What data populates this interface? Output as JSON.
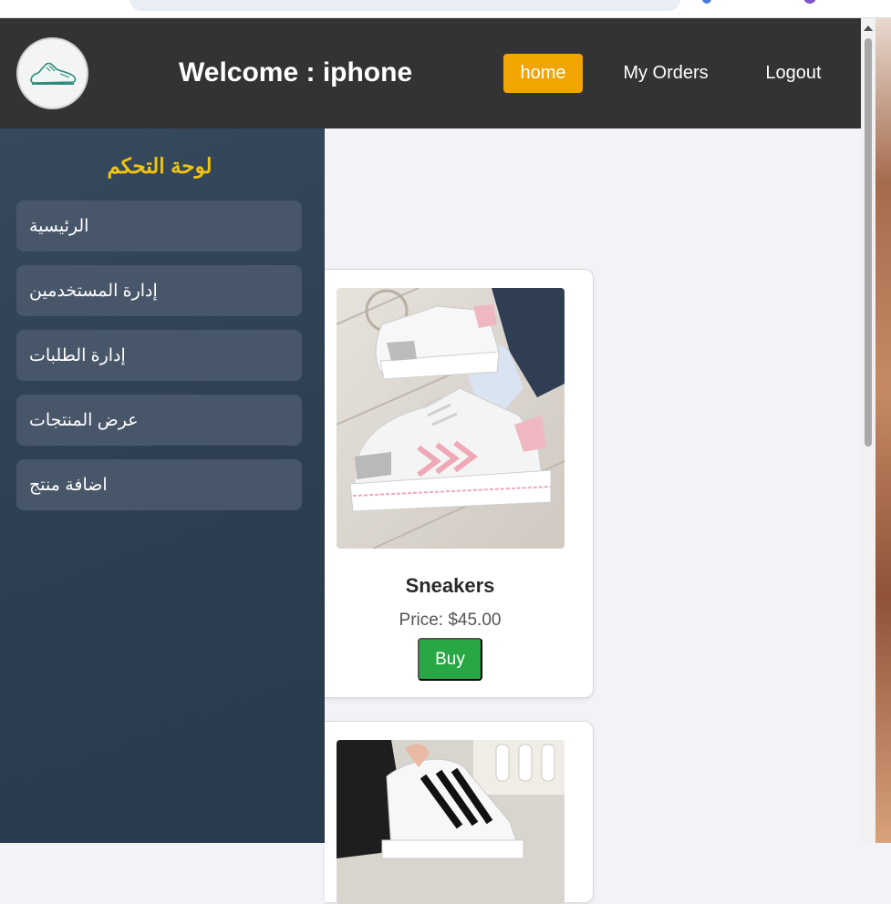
{
  "header": {
    "welcome": "Welcome : iphone",
    "nav": {
      "home": "home",
      "orders": "My Orders",
      "logout": "Logout"
    }
  },
  "sidebar": {
    "title": "لوحة التحكم",
    "items": [
      {
        "label": "الرئيسية"
      },
      {
        "label": "إدارة المستخدمين"
      },
      {
        "label": "إدارة الطلبات"
      },
      {
        "label": "عرض المنتجات"
      },
      {
        "label": "اضافة منتج"
      }
    ]
  },
  "products": [
    {
      "name": "Sneakers",
      "price": "Price: $45.00",
      "buy": "Buy"
    }
  ],
  "colors": {
    "topbar": "#333333",
    "accent": "#f0a500",
    "sidebar": "#2c3e50",
    "sidebar_title": "#f1c40f",
    "buy": "#28a745"
  },
  "icons": {
    "logo": "sneaker-logo-icon"
  }
}
